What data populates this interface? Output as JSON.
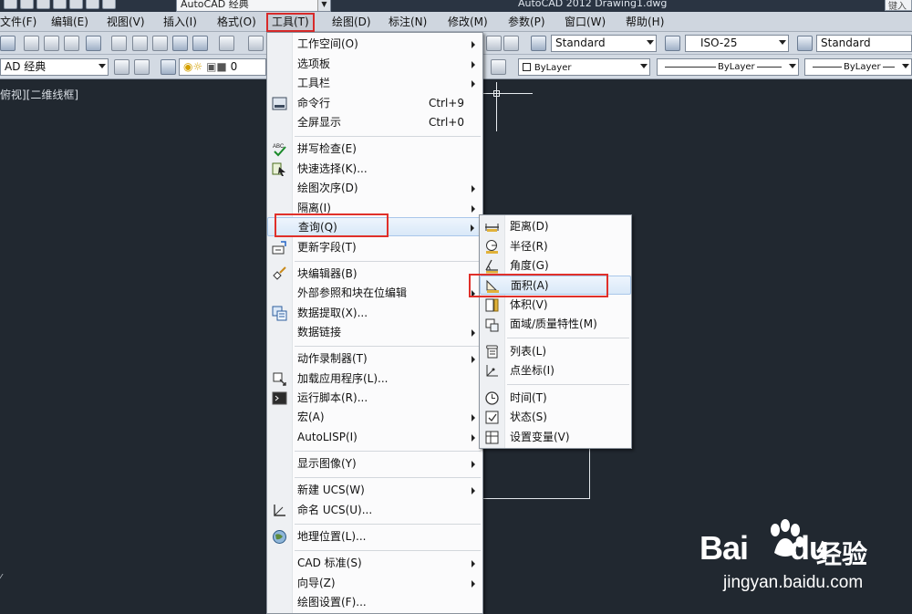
{
  "titlebar": {
    "workspace": "AutoCAD 经典",
    "app_title": "AutoCAD 2012    Drawing1.dwg",
    "search_placeholder": "键入"
  },
  "menubar": [
    {
      "label": "文件(F)"
    },
    {
      "label": "编辑(E)"
    },
    {
      "label": "视图(V)"
    },
    {
      "label": "插入(I)"
    },
    {
      "label": "格式(O)"
    },
    {
      "label": "工具(T)"
    },
    {
      "label": "绘图(D)"
    },
    {
      "label": "标注(N)"
    },
    {
      "label": "修改(M)"
    },
    {
      "label": "参数(P)"
    },
    {
      "label": "窗口(W)"
    },
    {
      "label": "帮助(H)"
    }
  ],
  "toolbar": {
    "text_style": "Standard",
    "dim_style": "ISO-25",
    "table_style": "Standard",
    "workspace2": "AD 经典",
    "layer_value": "0",
    "color": "ByLayer",
    "linetype": "ByLayer",
    "lineweight": "ByLayer"
  },
  "canvas": {
    "view_label": "俯视][二维线框]"
  },
  "tools_menu": {
    "items": [
      {
        "label": "工作空间(O)",
        "shortcut": "",
        "submenu": true,
        "icon": ""
      },
      {
        "label": "选项板",
        "shortcut": "",
        "submenu": true,
        "icon": ""
      },
      {
        "label": "工具栏",
        "shortcut": "",
        "submenu": true,
        "icon": ""
      },
      {
        "label": "命令行",
        "shortcut": "Ctrl+9",
        "submenu": false,
        "icon": "command-line-icon"
      },
      {
        "label": "全屏显示",
        "shortcut": "Ctrl+0",
        "submenu": false,
        "icon": ""
      },
      {
        "label": "拼写检查(E)",
        "shortcut": "",
        "submenu": false,
        "icon": "spell-check-icon"
      },
      {
        "label": "快速选择(K)...",
        "shortcut": "",
        "submenu": false,
        "icon": "quick-select-icon"
      },
      {
        "label": "绘图次序(D)",
        "shortcut": "",
        "submenu": true,
        "icon": ""
      },
      {
        "label": "隔离(I)",
        "shortcut": "",
        "submenu": true,
        "icon": ""
      },
      {
        "label": "查询(Q)",
        "shortcut": "",
        "submenu": true,
        "icon": ""
      },
      {
        "label": "更新字段(T)",
        "shortcut": "",
        "submenu": false,
        "icon": "update-field-icon"
      },
      {
        "label": "块编辑器(B)",
        "shortcut": "",
        "submenu": false,
        "icon": "block-editor-icon"
      },
      {
        "label": "外部参照和块在位编辑",
        "shortcut": "",
        "submenu": true,
        "icon": ""
      },
      {
        "label": "数据提取(X)...",
        "shortcut": "",
        "submenu": false,
        "icon": "data-extraction-icon"
      },
      {
        "label": "数据链接",
        "shortcut": "",
        "submenu": true,
        "icon": ""
      },
      {
        "label": "动作录制器(T)",
        "shortcut": "",
        "submenu": true,
        "icon": ""
      },
      {
        "label": "加载应用程序(L)...",
        "shortcut": "",
        "submenu": false,
        "icon": "load-application-icon"
      },
      {
        "label": "运行脚本(R)...",
        "shortcut": "",
        "submenu": false,
        "icon": "run-script-icon"
      },
      {
        "label": "宏(A)",
        "shortcut": "",
        "submenu": true,
        "icon": ""
      },
      {
        "label": "AutoLISP(I)",
        "shortcut": "",
        "submenu": true,
        "icon": ""
      },
      {
        "label": "显示图像(Y)",
        "shortcut": "",
        "submenu": true,
        "icon": ""
      },
      {
        "label": "新建 UCS(W)",
        "shortcut": "",
        "submenu": true,
        "icon": ""
      },
      {
        "label": "命名 UCS(U)...",
        "shortcut": "",
        "submenu": false,
        "icon": "named-ucs-icon"
      },
      {
        "label": "地理位置(L)...",
        "shortcut": "",
        "submenu": false,
        "icon": "geographic-location-icon"
      },
      {
        "label": "CAD 标准(S)",
        "shortcut": "",
        "submenu": true,
        "icon": ""
      },
      {
        "label": "向导(Z)",
        "shortcut": "",
        "submenu": true,
        "icon": ""
      },
      {
        "label": "绘图设置(F)...",
        "shortcut": "",
        "submenu": false,
        "icon": ""
      }
    ]
  },
  "query_menu": {
    "items": [
      {
        "label": "距离(D)",
        "icon": "distance-icon"
      },
      {
        "label": "半径(R)",
        "icon": "radius-icon"
      },
      {
        "label": "角度(G)",
        "icon": "angle-icon"
      },
      {
        "label": "面积(A)",
        "icon": "area-icon"
      },
      {
        "label": "体积(V)",
        "icon": "volume-icon"
      },
      {
        "label": "面域/质量特性(M)",
        "icon": "mass-properties-icon"
      },
      {
        "label": "列表(L)",
        "icon": "list-icon"
      },
      {
        "label": "点坐标(I)",
        "icon": "point-coordinate-icon"
      },
      {
        "label": "时间(T)",
        "icon": "time-icon"
      },
      {
        "label": "状态(S)",
        "icon": "status-icon"
      },
      {
        "label": "设置变量(V)",
        "icon": "set-variable-icon"
      }
    ]
  },
  "watermark": {
    "brand": "Bai",
    "brand_tail": "du",
    "product": "经验",
    "url": "jingyan.baidu.com"
  }
}
